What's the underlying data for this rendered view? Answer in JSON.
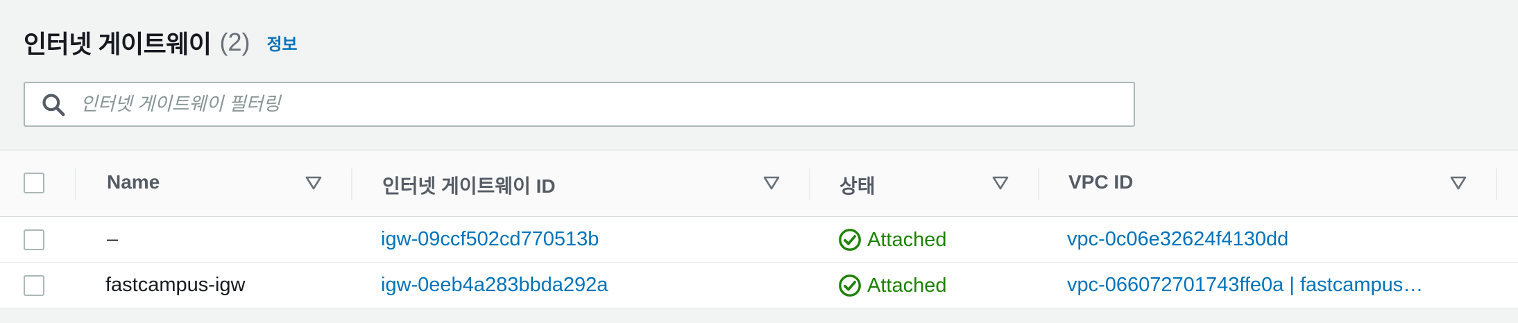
{
  "header": {
    "title": "인터넷 게이트웨이",
    "count": "(2)",
    "info_link": "정보"
  },
  "search": {
    "placeholder": "인터넷 게이트웨이 필터링",
    "value": ""
  },
  "table": {
    "columns": [
      {
        "label": "Name"
      },
      {
        "label": "인터넷 게이트웨이 ID"
      },
      {
        "label": "상태"
      },
      {
        "label": "VPC ID"
      }
    ],
    "rows": [
      {
        "name": "–",
        "igw_id": "igw-09ccf502cd770513b",
        "status": "Attached",
        "vpc_id": "vpc-0c06e32624f4130dd"
      },
      {
        "name": "fastcampus-igw",
        "igw_id": "igw-0eeb4a283bbda292a",
        "status": "Attached",
        "vpc_id": "vpc-066072701743ffe0a | fastcampus…"
      }
    ]
  },
  "icons": {
    "search": "search-icon",
    "sort": "sort-down-icon",
    "status": "check-circle-icon"
  },
  "colors": {
    "link": "#0073bb",
    "success": "#1d8102",
    "heading": "#16191f",
    "muted": "#687078",
    "border": "#aab7b8"
  }
}
